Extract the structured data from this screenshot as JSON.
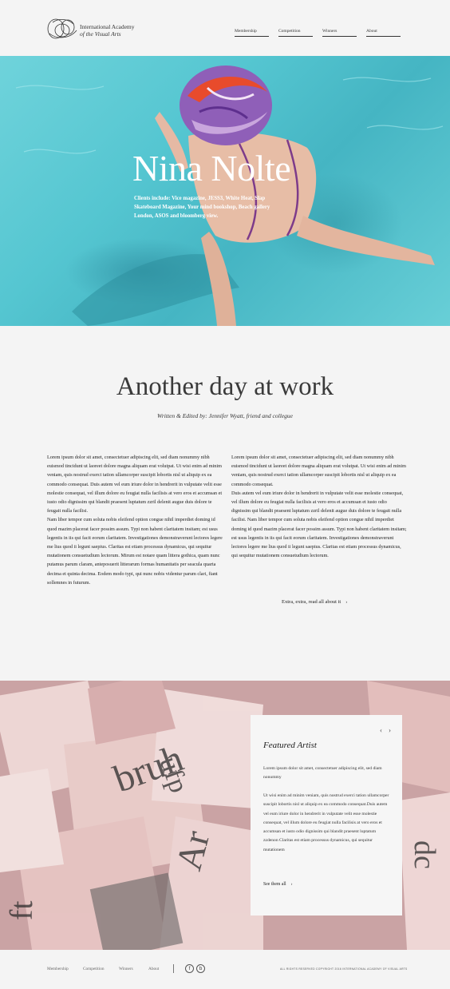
{
  "brand": {
    "line1": "International Academy",
    "line2": "of the Visual Arts"
  },
  "nav": {
    "items": [
      {
        "label": "Membership"
      },
      {
        "label": "Competition"
      },
      {
        "label": "Winners"
      },
      {
        "label": "About"
      }
    ]
  },
  "hero": {
    "title": "Nina Nolte",
    "subtitle": "Clients include: Vice magazine, JESS3, White Heat, Slap Skateboard Magazine, Your mind bookshop, Beach gallery London, ASOS and bloomberg view."
  },
  "article": {
    "title": "Another day at work",
    "byline": "Written & Edited by: Jennifer Wyatt, friend and collegue",
    "left_column": [
      "Lorem ipsum dolor sit amet, consectetuer adipiscing elit, sed diam nonummy nibh euismod tincidunt ut laoreet dolore magna aliquam erat volutpat. Ut wisi enim ad minim veniam, quis nostrud exerci tation ullamcorper suscipit lobortis nisl ut aliquip ex ea commodo consequat. Duis autem vel eum iriure dolor in hendrerit in vulputate velit esse molestie consequat, vel illum dolore eu feugiat nulla facilisis at vero eros et accumsan et iusto odio dignissim qui blandit praesent luptatum zzril delenit augue duis dolore te feugait nulla facilisi.",
      "Nam liber tempor cum soluta nobis eleifend option congue nihil imperdiet doming id quod mazim placerat facer possim assum. Typi non habent claritatem insitam; est usus legentis in iis qui facit eorum claritatem. Investigationes demonstraverunt lectores legere me lius quod ii legunt saepius. Claritas est etiam processus dynamicus, qui sequitur mutationem consuetudium lectorum. Mirum est notare quam littera gothica, quam nunc putamus parum claram, anteposuerit litterarum formas humanitatis per seacula quarta decima et quinta decima. Eodem modo typi, qui nunc nobis videntur parum clari, fiant sollemnes in futurum."
    ],
    "right_column": [
      "Lorem ipsum dolor sit amet, consectetuer adipiscing elit, sed diam nonummy nibh euismod tincidunt ut laoreet dolore magna aliquam erat volutpat. Ut wisi enim ad minim veniam, quis nostrud exerci tation ullamcorper suscipit lobortis nisl ut aliquip ex ea commodo consequat.",
      "Duis autem vel eum iriure dolor in hendrerit in vulputate velit esse molestie consequat, vel illum dolore eu feugiat nulla facilisis at vero eros et accumsan et iusto odio dignissim qui blandit praesent luptatum zzril delenit augue duis dolore te feugait nulla facilisi. Nam liber tempor cum soluta nobis eleifend option congue nihil imperdiet doming id quod mazim placerat facer possim assum. Typi non habent claritatem insitam; est usus legentis in iis qui facit eorum claritatem. Investigationes demonstraverunt lectores legere me lius quod ii legunt saepius. Claritas est etiam processus dynamicus, qui sequitur mutationem consuetudium lectorum."
    ],
    "read_more": "Extra, extra, read all about it",
    "read_more_icon": "chevron-right-icon"
  },
  "featured": {
    "title": "Featured Artist",
    "prev_icon": "chevron-left-icon",
    "next_icon": "chevron-right-icon",
    "paragraph1": "Lorem ipsum dolor sit amet, consectetuer adipiscing elit, sed diam nonummy",
    "paragraph2": "Ut wisi enim ad minim veniam, quis nostrud exerci tation ullamcorper suscipit lobortis nisl ut aliquip ex ea commodo consequat.Duis autem vel eum iriure dolor in hendrerit in vulputate velit esse molestie consequat, vel illum dolore eu feugiat nulla facilisis at vero eros et accumsan et iusto odio dignissim qui blandit praesent luptatum zzdenon Claritas est etiam processus dynamicus, qui sequitur mutationem",
    "link": "See them all"
  },
  "footer": {
    "items": [
      {
        "label": "Membership"
      },
      {
        "label": "Competition"
      },
      {
        "label": "Winners"
      },
      {
        "label": "About"
      }
    ],
    "social": [
      {
        "icon": "facebook-icon",
        "glyph": "f"
      },
      {
        "icon": "behance-icon",
        "glyph": "b"
      }
    ],
    "copyright": "ALL RIGHTS RESERVED COPYRIGHT 2016 INTERNATIONAL ACADEMY OF VISUAL ARTS"
  },
  "colors": {
    "page_bg": "#f4f4f4",
    "pool": "#55c6d1",
    "banner_bg": "#d8b5b5",
    "text": "#333333"
  }
}
